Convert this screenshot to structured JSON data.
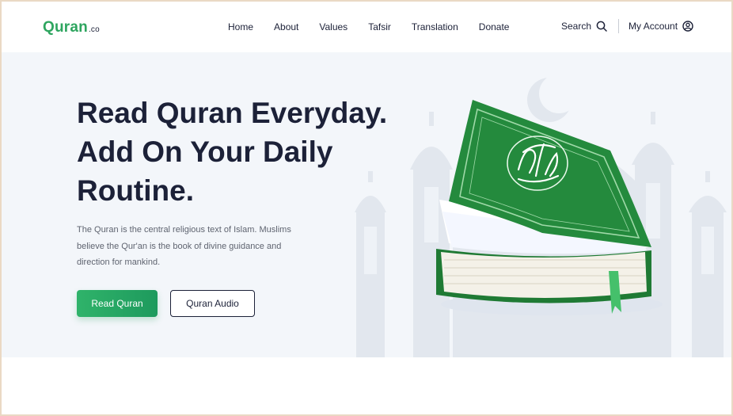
{
  "brand": {
    "name": "Quran",
    "tld": ".co",
    "accent": "#2ea55f"
  },
  "nav": [
    {
      "label": "Home"
    },
    {
      "label": "About"
    },
    {
      "label": "Values"
    },
    {
      "label": "Tafsir"
    },
    {
      "label": "Translation"
    },
    {
      "label": "Donate"
    }
  ],
  "tools": {
    "search_label": "Search",
    "account_label": "My Account"
  },
  "hero": {
    "headline": [
      "Read Quran Everyday.",
      "Add On Your Daily",
      "Routine."
    ],
    "description": "The Quran is the central religious text of Islam. Muslims believe the Qur'an is the book of divine guidance and direction for mankind.",
    "primary_button": "Read Quran",
    "secondary_button": "Quran Audio"
  },
  "icons": {
    "search": "search-icon",
    "account": "user-circle-icon",
    "illustration": "quran-book-illustration",
    "background": "mosque-silhouette"
  }
}
